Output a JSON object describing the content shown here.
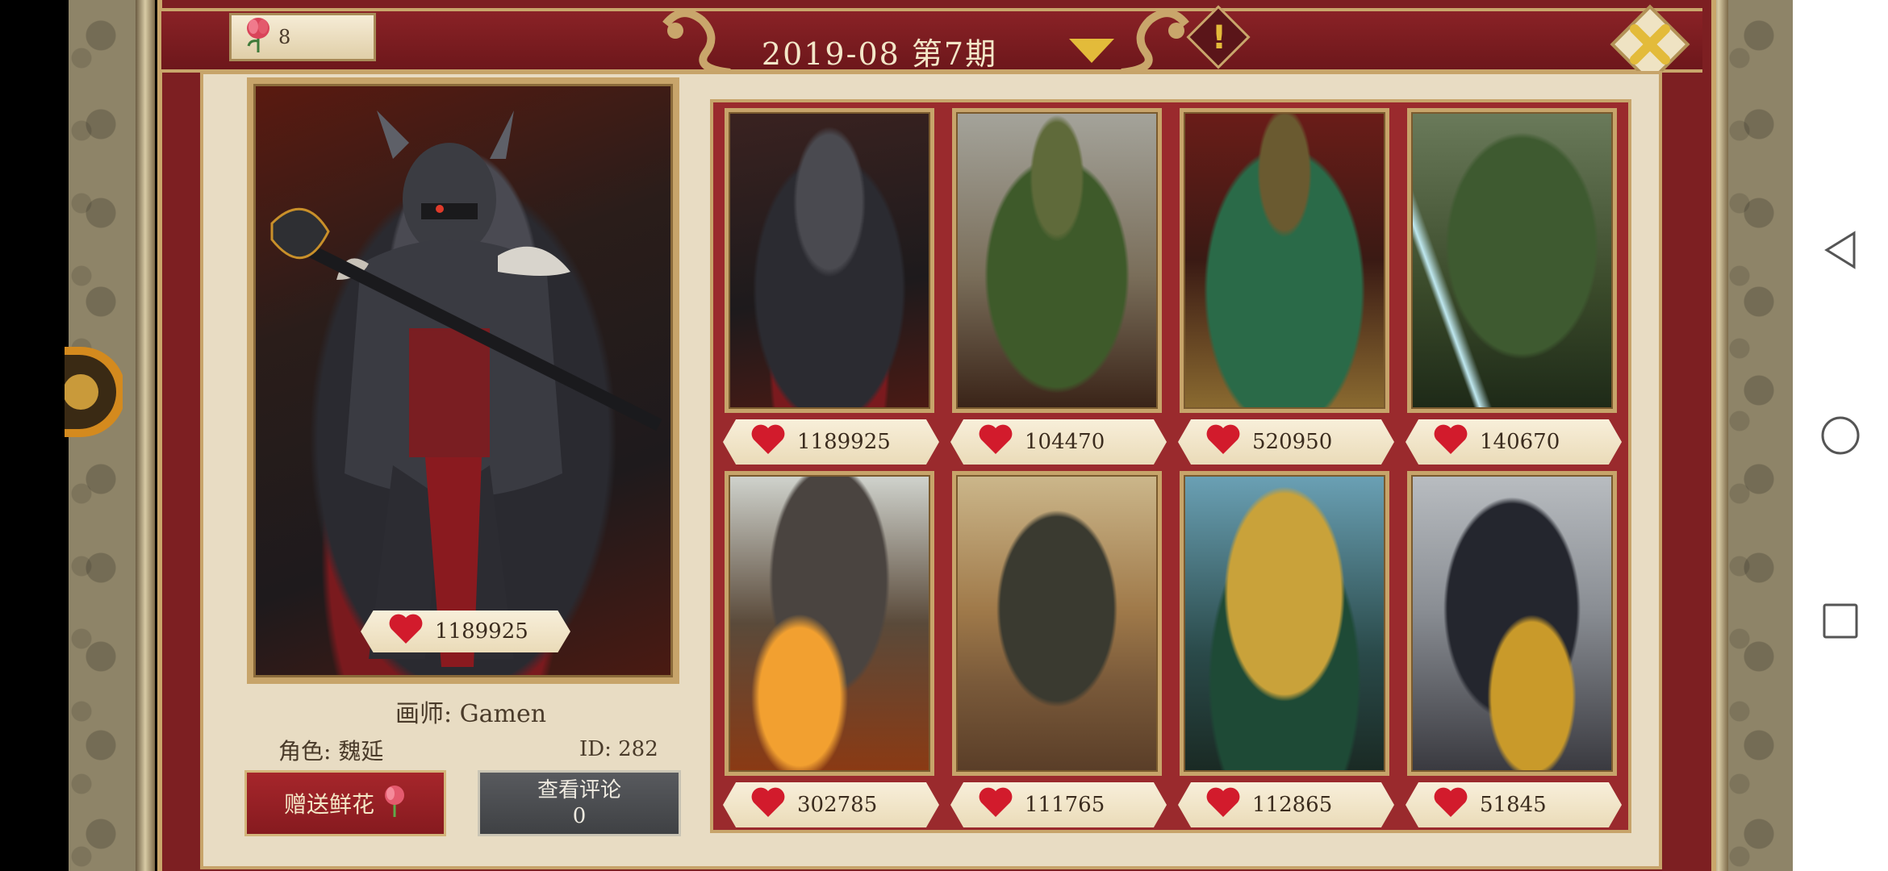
{
  "header": {
    "flower_count": "8",
    "title": "2019-08 第7期"
  },
  "featured": {
    "likes": "1189925",
    "artist": "画师: Gamen",
    "role": "角色: 魏延",
    "id": "ID: 282"
  },
  "buttons": {
    "gift_label": "赠送鲜花",
    "comments_label": "查看评论",
    "comments_count": "0"
  },
  "cards": [
    {
      "likes": "1189925",
      "theme": "dark-red"
    },
    {
      "likes": "104470",
      "theme": "green-armor"
    },
    {
      "likes": "520950",
      "theme": "green-robe"
    },
    {
      "likes": "140670",
      "theme": "green-sword"
    },
    {
      "likes": "302785",
      "theme": "fire"
    },
    {
      "likes": "111765",
      "theme": "tent"
    },
    {
      "likes": "112865",
      "theme": "gold-green"
    },
    {
      "likes": "51845",
      "theme": "silver"
    }
  ],
  "colors": {
    "frame_red": "#7d1f22",
    "parchment": "#e8dcc3",
    "gold": "#c7a46a",
    "heart_red": "#d21b2c"
  },
  "icons": [
    "flower-icon",
    "dropdown-arrow-icon",
    "info-icon",
    "close-icon",
    "heart-icon",
    "back-icon",
    "home-icon",
    "recents-icon"
  ]
}
